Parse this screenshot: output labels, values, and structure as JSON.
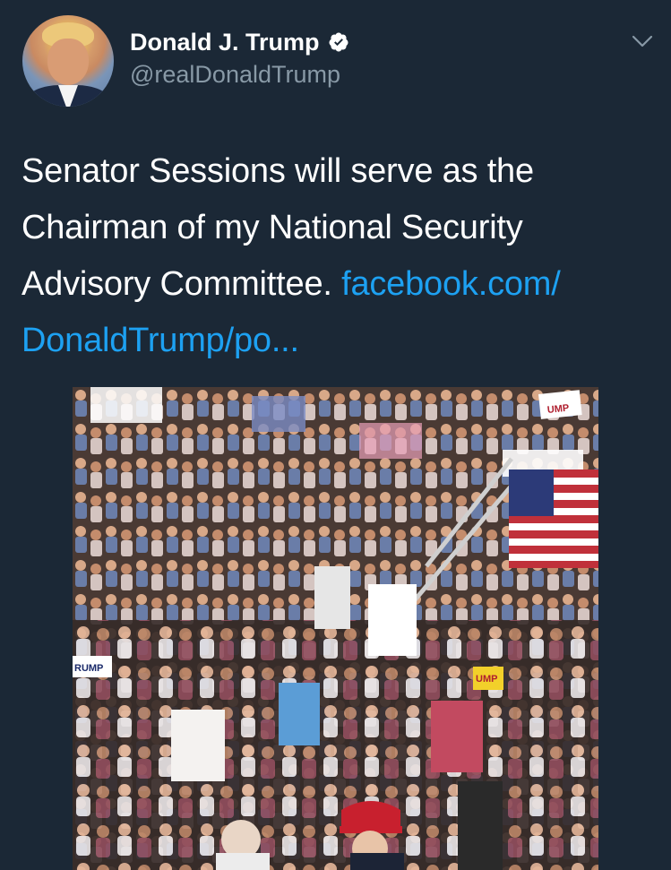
{
  "user": {
    "display_name": "Donald J. Trump",
    "handle": "@realDonaldTrump",
    "verified": true,
    "avatar_icon": "profile-photo"
  },
  "tweet": {
    "text": "Senator Sessions will serve as the Chairman of my National Security Advisory Committee. ",
    "link_text": "facebook.com/ DonaldTrump/po...",
    "link_color": "#1da1f2"
  },
  "media": {
    "sign_labels": [
      "UMP",
      "RUMP",
      "UMP"
    ]
  },
  "colors": {
    "background": "#1b2836",
    "secondary_text": "#8899a6",
    "verified_badge": "#ffffff"
  }
}
